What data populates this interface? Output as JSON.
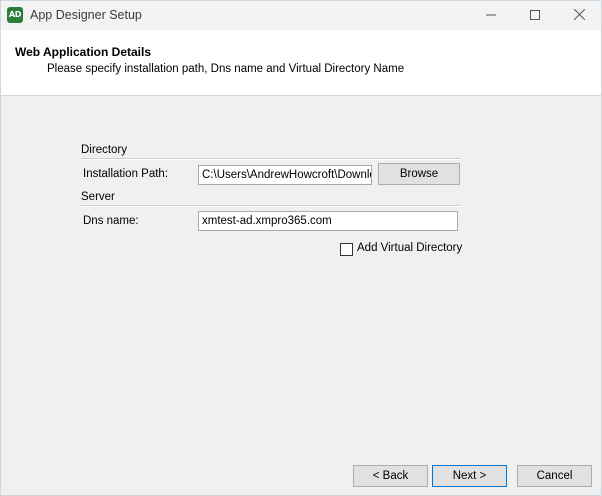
{
  "window": {
    "title": "App Designer Setup",
    "app_icon_text": "AD",
    "icons": {
      "minimize": "minimize-icon",
      "maximize": "maximize-icon",
      "close": "close-icon"
    }
  },
  "header": {
    "title": "Web Application Details",
    "subtitle": "Please specify installation path, Dns name and Virtual Directory Name"
  },
  "directory": {
    "group_label": "Directory",
    "path_label": "Installation Path:",
    "path_value": "C:\\Users\\AndrewHowcroft\\Downloads",
    "browse_label": "Browse"
  },
  "server": {
    "group_label": "Server",
    "dns_label": "Dns name:",
    "dns_value": "xmtest-ad.xmpro365.com",
    "virtual_dir_label": "Add Virtual Directory",
    "virtual_dir_checked": false
  },
  "footer": {
    "back_label": "< Back",
    "next_label": "Next >",
    "cancel_label": "Cancel"
  },
  "colors": {
    "icon_bg": "#2d7d3a",
    "default_button_border": "#0078d7",
    "window_bg": "#f0f0f0"
  }
}
